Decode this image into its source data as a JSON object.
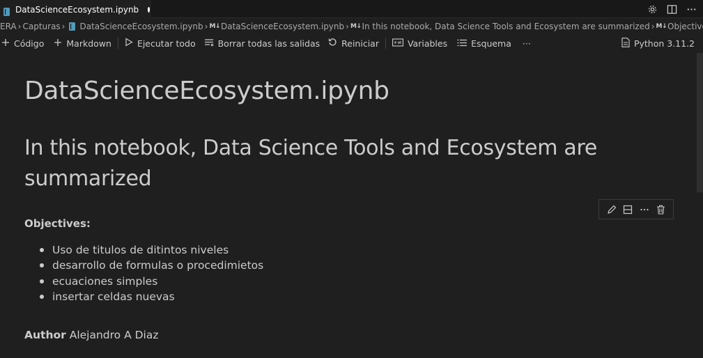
{
  "tab": {
    "title": "DataScienceEcosystem.ipynb",
    "modified": true
  },
  "tab_actions": [
    "settings-icon",
    "split-editor-icon",
    "more-icon"
  ],
  "breadcrumb": {
    "items": [
      "ERA",
      "Capturas",
      "DataScienceEcosystem.ipynb",
      "DataScienceEcosystem.ipynb",
      "In this notebook, Data Science Tools and Ecosystem are summarized",
      "Objectives:"
    ],
    "md_mark": "M↓"
  },
  "toolbar": {
    "code": "Código",
    "markdown": "Markdown",
    "run_all": "Ejecutar todo",
    "clear_outputs": "Borrar todas las salidas",
    "restart": "Reiniciar",
    "variables": "Variables",
    "outline": "Esquema",
    "more": "···",
    "kernel": "Python 3.11.2"
  },
  "notebook": {
    "h1": "DataScienceEcosystem.ipynb",
    "h2": "In this notebook, Data Science Tools and Ecosystem are summarized",
    "objectives_label": "Objectives:",
    "objectives": [
      "Uso de titulos de ditintos niveles",
      "desarrollo de formulas o procedimietos",
      "ecuaciones simples",
      "insertar celdas nuevas"
    ],
    "author_label": "Author",
    "author_name": "Alejandro A Diaz"
  },
  "cell_toolbar": [
    "edit-icon",
    "split-cell-icon",
    "more-icon",
    "delete-icon"
  ],
  "colors": {
    "background": "#1f1f1f",
    "tabbar": "#181818",
    "text": "#cccccc",
    "notebook_icon": "#519aba"
  }
}
